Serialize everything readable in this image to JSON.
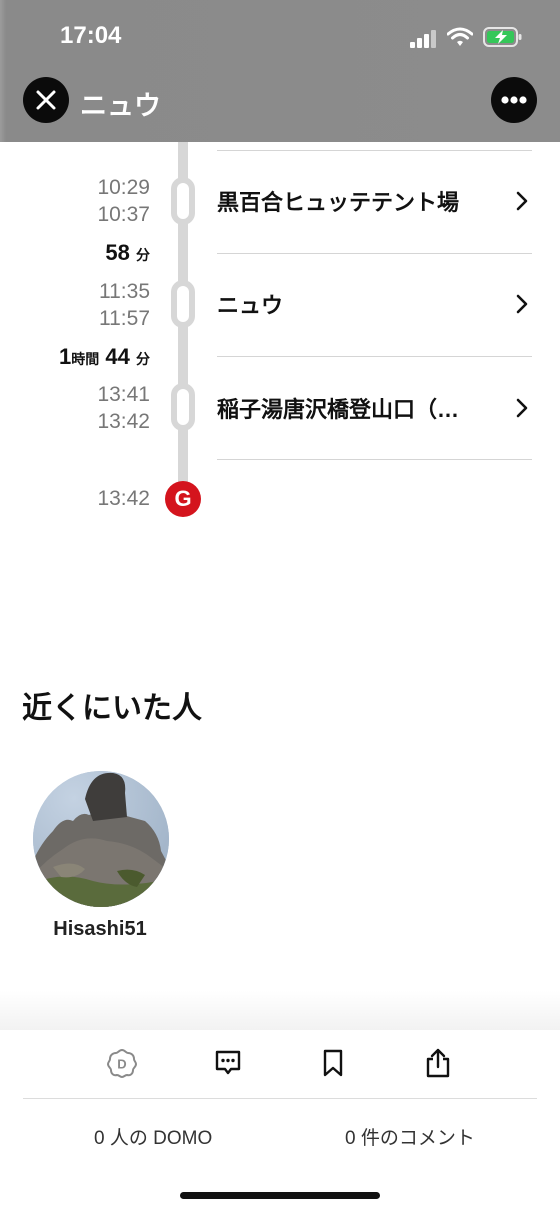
{
  "status_bar": {
    "time": "17:04"
  },
  "header": {
    "title": "ニュウ",
    "close_icon": "close-icon",
    "more_icon": "more-horizontal-icon"
  },
  "timeline": {
    "stops": [
      {
        "arrive": "10:29",
        "depart": "10:37",
        "name": "黒百合ヒュッテテント場"
      },
      {
        "arrive": "11:35",
        "depart": "11:57",
        "name": "ニュウ"
      },
      {
        "arrive": "13:41",
        "depart": "13:42",
        "name": "稲子湯唐沢橋登山口（…"
      }
    ],
    "durations": [
      {
        "value": "58",
        "unit": "分"
      },
      {
        "hours": "1",
        "hours_unit": "時間",
        "minutes": "44",
        "minutes_unit": "分"
      }
    ],
    "goal": {
      "time": "13:42",
      "marker": "G"
    }
  },
  "nearby": {
    "title": "近くにいた人",
    "users": [
      {
        "name": "Hisashi51"
      }
    ]
  },
  "bottom_bar": {
    "domo_count_label": "0 人の DOMO",
    "comment_count_label": "0 件のコメント",
    "icons": [
      "domo-icon",
      "comment-icon",
      "bookmark-icon",
      "share-icon"
    ]
  },
  "colors": {
    "goal_red": "#d4141d",
    "header_gray": "#8c8c8c",
    "rail_gray": "#d7d7d7"
  }
}
